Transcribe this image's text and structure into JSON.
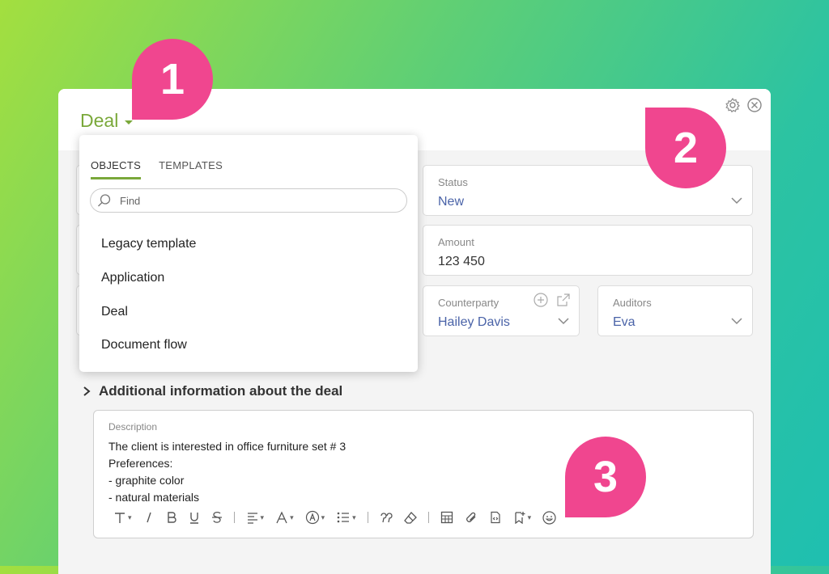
{
  "header": {
    "title": "Deal",
    "settings_icon": "gear-icon",
    "close_icon": "close-circle-icon"
  },
  "dropdown": {
    "tabs": [
      {
        "label": "OBJECTS",
        "active": true
      },
      {
        "label": "TEMPLATES",
        "active": false
      }
    ],
    "search_placeholder": "Find",
    "items": [
      "Legacy template",
      "Application",
      "Deal",
      "Document flow"
    ]
  },
  "fields": {
    "status": {
      "label": "Status",
      "value": "New"
    },
    "amount": {
      "label": "Amount",
      "value": "123 450"
    },
    "counterparty": {
      "label": "Counterparty",
      "value": "Hailey Davis"
    },
    "auditors": {
      "label": "Auditors",
      "value": "Eva"
    }
  },
  "section": {
    "title": "Additional information about the deal"
  },
  "description": {
    "label": "Description",
    "lines": [
      "The client is interested in office furniture set # 3",
      "Preferences:",
      "- graphite color",
      "- natural materials"
    ]
  },
  "toolbar": [
    "text-style-icon",
    "italic-icon",
    "bold-icon",
    "underline-icon",
    "strikethrough-icon",
    "align-icon",
    "font-color-icon",
    "highlight-icon",
    "list-icon",
    "quote-icon",
    "eraser-icon",
    "table-icon",
    "attach-icon",
    "code-icon",
    "bookmark-icon",
    "emoji-icon"
  ],
  "callouts": [
    "1",
    "2",
    "3"
  ],
  "colors": {
    "accent": "#7aa83a",
    "callout": "#f0468f",
    "link": "#4a63a8"
  }
}
